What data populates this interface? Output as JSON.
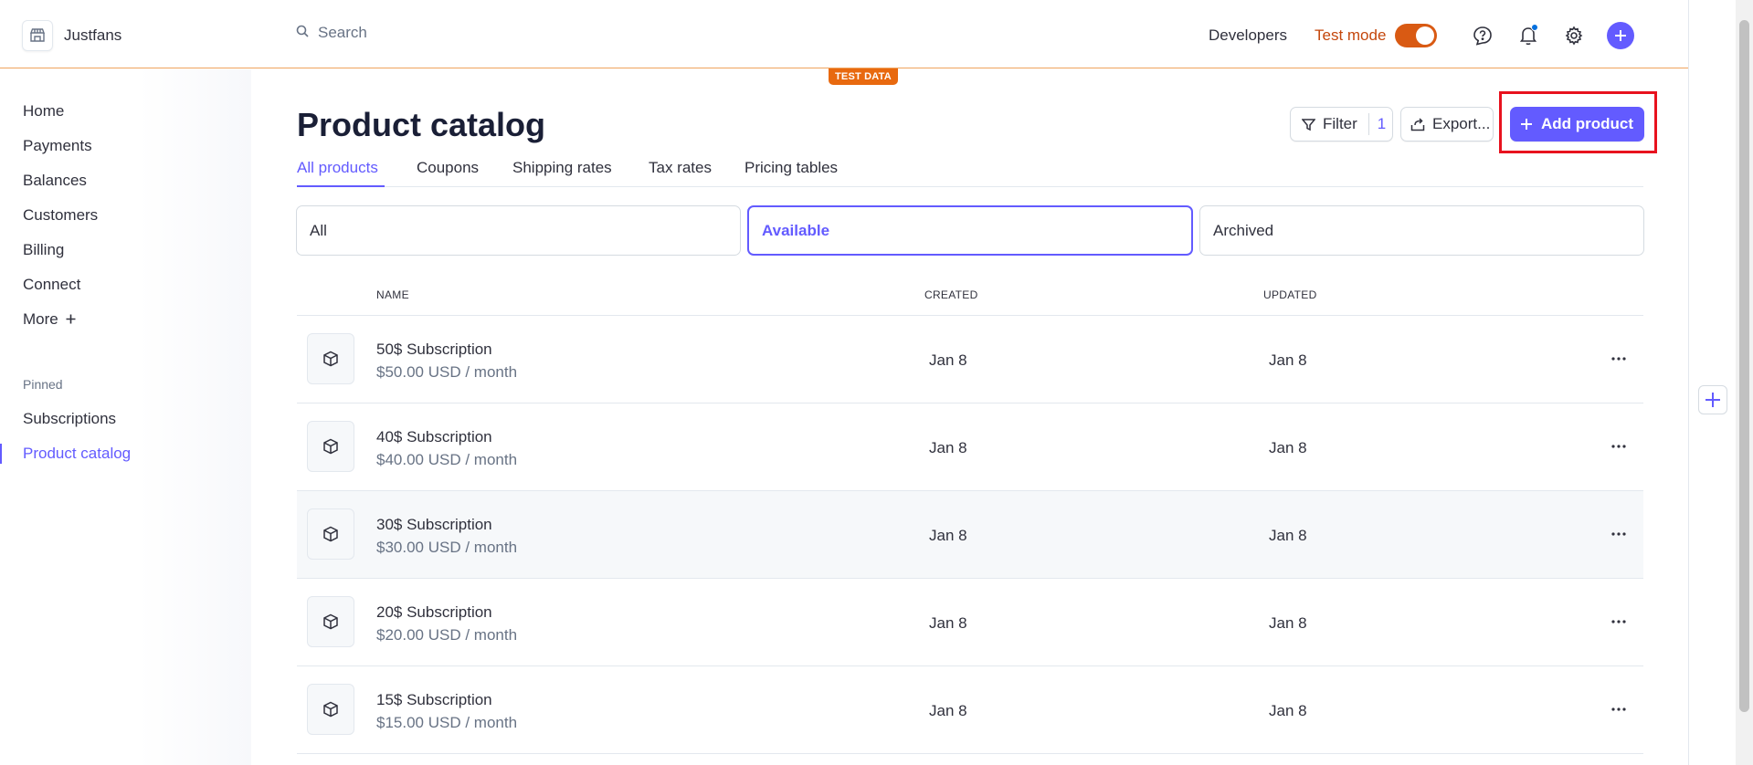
{
  "header": {
    "brand": "Justfans",
    "search_placeholder": "Search",
    "developers": "Developers",
    "test_mode": "Test mode",
    "test_badge": "TEST DATA"
  },
  "sidebar": {
    "items": [
      {
        "label": "Home"
      },
      {
        "label": "Payments"
      },
      {
        "label": "Balances"
      },
      {
        "label": "Customers"
      },
      {
        "label": "Billing"
      },
      {
        "label": "Connect"
      },
      {
        "label": "More"
      }
    ],
    "pinned_label": "Pinned",
    "pinned": [
      {
        "label": "Subscriptions"
      },
      {
        "label": "Product catalog",
        "active": true
      }
    ]
  },
  "main": {
    "title": "Product catalog",
    "filter_label": "Filter",
    "filter_count": "1",
    "export_label": "Export...",
    "add_label": "Add product",
    "tabs": [
      {
        "label": "All products",
        "active": true
      },
      {
        "label": "Coupons"
      },
      {
        "label": "Shipping rates"
      },
      {
        "label": "Tax rates"
      },
      {
        "label": "Pricing tables"
      }
    ],
    "segments": [
      {
        "label": "All"
      },
      {
        "label": "Available",
        "active": true
      },
      {
        "label": "Archived"
      }
    ],
    "columns": [
      "NAME",
      "CREATED",
      "UPDATED"
    ],
    "rows": [
      {
        "name": "50$ Subscription",
        "price": "$50.00 USD / month",
        "created": "Jan 8",
        "updated": "Jan 8"
      },
      {
        "name": "40$ Subscription",
        "price": "$40.00 USD / month",
        "created": "Jan 8",
        "updated": "Jan 8"
      },
      {
        "name": "30$ Subscription",
        "price": "$30.00 USD / month",
        "created": "Jan 8",
        "updated": "Jan 8"
      },
      {
        "name": "20$ Subscription",
        "price": "$20.00 USD / month",
        "created": "Jan 8",
        "updated": "Jan 8"
      },
      {
        "name": "15$ Subscription",
        "price": "$15.00 USD / month",
        "created": "Jan 8",
        "updated": "Jan 8"
      }
    ]
  },
  "colors": {
    "accent": "#635bff",
    "test_mode": "#d95a13",
    "highlight": "#e8121e"
  }
}
